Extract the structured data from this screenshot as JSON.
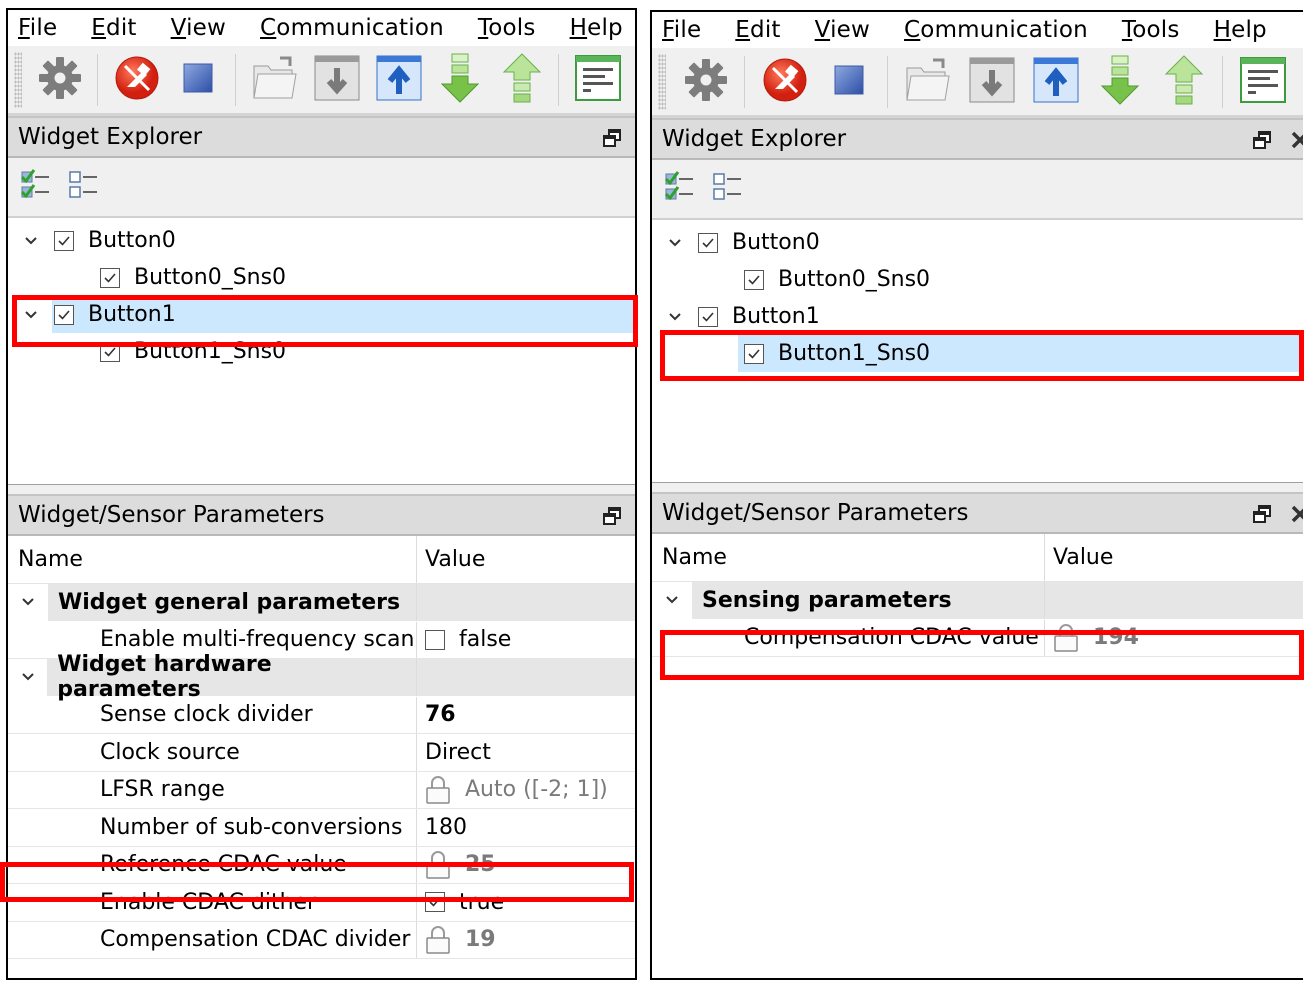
{
  "panes": [
    {
      "menu": [
        {
          "mnemonic": "F",
          "rest": "ile"
        },
        {
          "mnemonic": "E",
          "rest": "dit"
        },
        {
          "mnemonic": "V",
          "rest": "iew"
        },
        {
          "mnemonic": "C",
          "rest": "ommunication"
        },
        {
          "mnemonic": "T",
          "rest": "ools"
        },
        {
          "mnemonic": "H",
          "rest": "elp"
        }
      ],
      "toolbar_icons": [
        "gear-icon",
        "disconnect-icon",
        "stop-icon",
        "open-folder-icon",
        "read-window-icon",
        "write-window-icon",
        "import-arrow-down-icon",
        "export-arrow-up-icon",
        "log-icon"
      ],
      "explorer": {
        "title": "Widget Explorer",
        "tree": [
          {
            "label": "Button0",
            "level": 0,
            "checked": true,
            "expanded": true,
            "selected": false
          },
          {
            "label": "Button0_Sns0",
            "level": 1,
            "checked": true,
            "selected": false
          },
          {
            "label": "Button1",
            "level": 0,
            "checked": true,
            "expanded": true,
            "selected": true
          },
          {
            "label": "Button1_Sns0",
            "level": 1,
            "checked": true,
            "selected": false
          }
        ]
      },
      "parameters": {
        "title": "Widget/Sensor Parameters",
        "col_name": "Name",
        "col_value": "Value",
        "rows": [
          {
            "type": "group",
            "name": "Widget general parameters"
          },
          {
            "type": "param",
            "name": "Enable multi-frequency scan",
            "value": "false",
            "kind": "checkbox",
            "checked": false
          },
          {
            "type": "group",
            "name": "Widget hardware parameters"
          },
          {
            "type": "param",
            "name": "Sense clock divider",
            "value": "76",
            "kind": "bold"
          },
          {
            "type": "param",
            "name": "Clock source",
            "value": "Direct",
            "kind": "text"
          },
          {
            "type": "param",
            "name": "LFSR range",
            "value": "Auto ([-2; 1])",
            "kind": "locked"
          },
          {
            "type": "param",
            "name": "Number of sub-conversions",
            "value": "180",
            "kind": "text"
          },
          {
            "type": "param",
            "name": "Reference CDAC value",
            "value": "25",
            "kind": "locked-bold",
            "highlighted": true
          },
          {
            "type": "param",
            "name": "Enable CDAC dither",
            "value": "true",
            "kind": "checkbox",
            "checked": true
          },
          {
            "type": "param",
            "name": "Compensation CDAC divider",
            "value": "19",
            "kind": "locked-bold"
          }
        ]
      }
    },
    {
      "menu": [
        {
          "mnemonic": "F",
          "rest": "ile"
        },
        {
          "mnemonic": "E",
          "rest": "dit"
        },
        {
          "mnemonic": "V",
          "rest": "iew"
        },
        {
          "mnemonic": "C",
          "rest": "ommunication"
        },
        {
          "mnemonic": "T",
          "rest": "ools"
        },
        {
          "mnemonic": "H",
          "rest": "elp"
        }
      ],
      "explorer": {
        "title": "Widget Explorer",
        "tree": [
          {
            "label": "Button0",
            "level": 0,
            "checked": true,
            "expanded": true,
            "selected": false
          },
          {
            "label": "Button0_Sns0",
            "level": 1,
            "checked": true,
            "selected": false
          },
          {
            "label": "Button1",
            "level": 0,
            "checked": true,
            "expanded": true,
            "selected": false
          },
          {
            "label": "Button1_Sns0",
            "level": 1,
            "checked": true,
            "selected": true
          }
        ]
      },
      "parameters": {
        "title": "Widget/Sensor Parameters",
        "col_name": "Name",
        "col_value": "Value",
        "rows": [
          {
            "type": "group",
            "name": "Sensing parameters"
          },
          {
            "type": "param",
            "name": "Compensation CDAC value",
            "value": "194",
            "kind": "locked-bold",
            "highlighted": true
          }
        ]
      }
    }
  ],
  "colors": {
    "highlight": "#ff0000",
    "selection": "#cce8ff",
    "group_bg": "#e6e6e6",
    "dock_title_bg": "#dcdcdc"
  }
}
